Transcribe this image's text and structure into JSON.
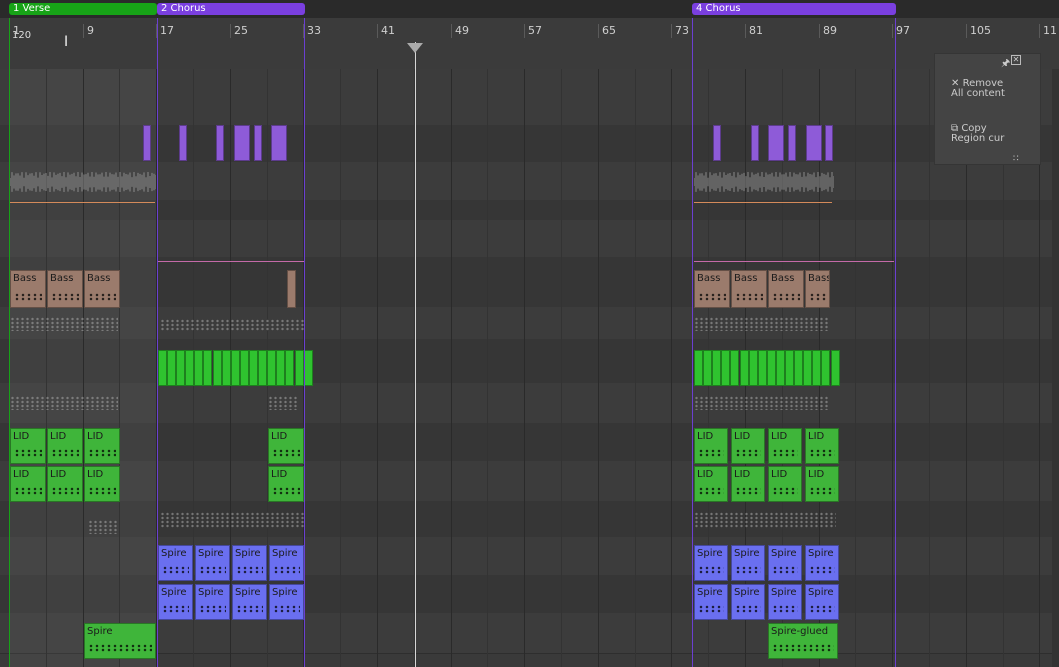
{
  "tempo": "120",
  "markers": [
    {
      "label": "1  Verse",
      "color": "#17a317"
    },
    {
      "label": "2  Chorus",
      "color": "#7a3fe0"
    },
    {
      "label": "4  Chorus",
      "color": "#7a3fe0"
    }
  ],
  "bars": [
    "1",
    "9",
    "17",
    "25",
    "33",
    "41",
    "49",
    "57",
    "65",
    "73",
    "81",
    "89",
    "97",
    "105",
    "11"
  ],
  "clip_labels": {
    "bass": "Bass",
    "lid": "LID",
    "spire": "Spire",
    "spire_glued": "Spire-glued"
  },
  "panel": {
    "remove_line1": "Remove",
    "remove_line2": "All content",
    "copy_line1": "Copy",
    "copy_line2": "Region cur"
  },
  "colors": {
    "bass": "#9b7b6c",
    "green": "#3fb53a",
    "bright_green": "#2fc32f",
    "purple": "#8e5bd8",
    "spire": "#6a6ff0",
    "chorus": "#7a3fe0",
    "verse": "#17a317"
  },
  "icons": {
    "remove": "close-x-icon",
    "copy": "copy-icon",
    "pin": "pin-icon",
    "close": "close-box-icon",
    "resize": "resize-grip-icon",
    "cursor": "text-cursor-icon",
    "playhead": "playhead-triangle-icon"
  }
}
